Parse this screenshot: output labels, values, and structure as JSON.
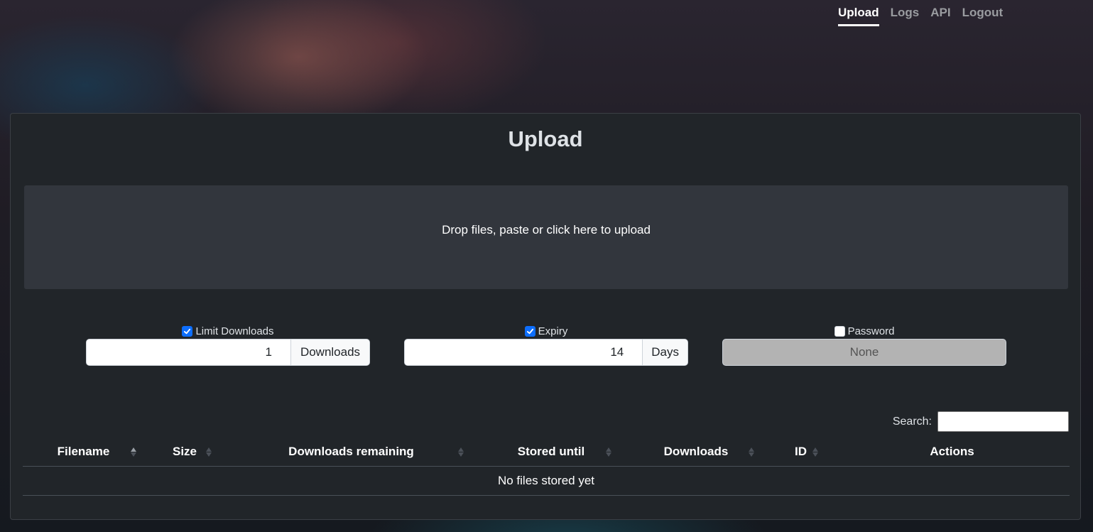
{
  "nav": {
    "items": [
      {
        "label": "Upload",
        "active": true
      },
      {
        "label": "Logs",
        "active": false
      },
      {
        "label": "API",
        "active": false
      },
      {
        "label": "Logout",
        "active": false
      }
    ]
  },
  "upload": {
    "title": "Upload",
    "dropzone_text": "Drop files, paste or click here to upload"
  },
  "options": {
    "limit_downloads": {
      "label": "Limit Downloads",
      "checked": true,
      "value": "1",
      "unit": "Downloads"
    },
    "expiry": {
      "label": "Expiry",
      "checked": true,
      "value": "14",
      "unit": "Days"
    },
    "password": {
      "label": "Password",
      "checked": false,
      "value": "None"
    }
  },
  "table": {
    "search_label": "Search:",
    "columns": [
      {
        "label": "Filename",
        "sort": "asc"
      },
      {
        "label": "Size",
        "sort": "none"
      },
      {
        "label": "Downloads remaining",
        "sort": "none"
      },
      {
        "label": "Stored until",
        "sort": "none"
      },
      {
        "label": "Downloads",
        "sort": "none"
      },
      {
        "label": "ID",
        "sort": "none"
      },
      {
        "label": "Actions",
        "sort": null
      }
    ],
    "empty_text": "No files stored yet"
  },
  "colors": {
    "accent": "#0d6efd",
    "card_background": "#212529",
    "dropzone_background": "#32363d"
  },
  "icons": {
    "checkbox_checked": "check-icon",
    "sort": "sort-icon"
  }
}
